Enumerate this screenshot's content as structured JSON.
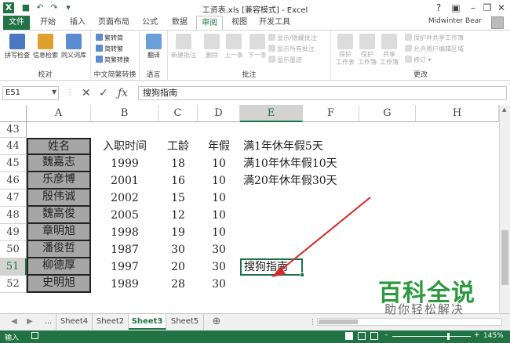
{
  "window": {
    "title": "工资表.xls  [兼容模式] - Excel",
    "user": "Midwinter Bear"
  },
  "tabs": [
    "文件",
    "开始",
    "插入",
    "页面布局",
    "公式",
    "数据",
    "审阅",
    "视图",
    "开发工具"
  ],
  "active_tab": "审阅",
  "ribbon": {
    "proofing": {
      "label": "校对",
      "spell": "拼写检查",
      "research": "信息检索",
      "thesaurus": "同义词库"
    },
    "chinese": {
      "label": "中文简繁转换",
      "to_trad": "繁转简",
      "to_simp": "简转繁",
      "convert": "简繁转换"
    },
    "language": {
      "label": "语言",
      "translate": "翻译"
    },
    "comments": {
      "label": "批注",
      "new": "新建批注",
      "delete": "删除",
      "prev": "上一条",
      "next": "下一条",
      "show_hide": "显示/隐藏批注",
      "show_all": "显示所有批注",
      "show_ink": "显示墨迹"
    },
    "changes": {
      "label": "更改",
      "protect_sheet": "保护\n工作表",
      "protect_wb": "保护\n工作簿",
      "share_wb": "共享\n工作簿",
      "protect_share": "保护并共享工作簿",
      "allow_edit": "允许用户编辑区域",
      "track": "修订"
    }
  },
  "formula_bar": {
    "name_box": "E51",
    "content": "搜狗指南"
  },
  "columns": [
    "A",
    "B",
    "C",
    "D",
    "E",
    "F",
    "G",
    "H"
  ],
  "selected_column": "E",
  "rows": [
    "43",
    "44",
    "45",
    "46",
    "47",
    "48",
    "49",
    "50",
    "51",
    "52"
  ],
  "selected_row": "51",
  "headers": {
    "name": "姓名",
    "date": "入职时间",
    "years": "工龄",
    "leave": "年假"
  },
  "table": [
    {
      "name": "魏嘉志",
      "date": "1999",
      "years": "18",
      "leave": "10"
    },
    {
      "name": "乐彦博",
      "date": "2001",
      "years": "16",
      "leave": "10"
    },
    {
      "name": "殷伟诚",
      "date": "2002",
      "years": "15",
      "leave": "10"
    },
    {
      "name": "魏高俊",
      "date": "2005",
      "years": "12",
      "leave": "10"
    },
    {
      "name": "章明旭",
      "date": "1998",
      "years": "19",
      "leave": "10"
    },
    {
      "name": "潘俊哲",
      "date": "1987",
      "years": "30",
      "leave": "30"
    },
    {
      "name": "柳德厚",
      "date": "1997",
      "years": "20",
      "leave": "30"
    },
    {
      "name": "史明旭",
      "date": "1989",
      "years": "28",
      "leave": "30"
    }
  ],
  "notes": [
    "满1年休年假5天",
    "满10年休年假10天",
    "满20年休年假30天"
  ],
  "active_cell_text": "搜狗指南",
  "sheets": [
    "Sheet4",
    "Sheet2",
    "Sheet3",
    "Sheet5"
  ],
  "active_sheet": "Sheet3",
  "status": {
    "mode": "输入",
    "zoom": "145%"
  },
  "watermark": {
    "main": "百科全说",
    "sub": "助你轻松解决"
  },
  "colors": {
    "accent": "#217346",
    "name_fill": "#a6a6a6",
    "arrow": "#d42a2a",
    "watermark": "#2c9a3e"
  }
}
